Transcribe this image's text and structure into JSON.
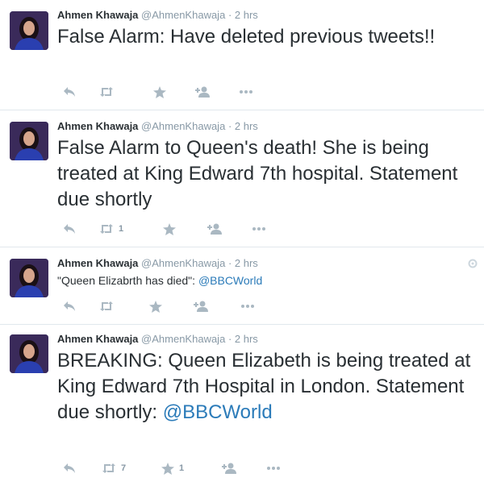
{
  "colors": {
    "link": "#2b7bb9",
    "muted": "#8899a6",
    "icon": "#aab8c2",
    "divider": "#e1e8ed"
  },
  "tweets": [
    {
      "name": "Ahmen Khawaja",
      "handle": "@AhmenKhawaja",
      "sep": "·",
      "time": "2 hrs",
      "text": "False Alarm: Have deleted previous tweets!!",
      "mention": "",
      "retweets": "",
      "favorites": ""
    },
    {
      "name": "Ahmen Khawaja",
      "handle": "@AhmenKhawaja",
      "sep": "·",
      "time": "2 hrs",
      "text": "False Alarm to Queen's death! She is being treated at King Edward 7th hospital. Statement due shortly",
      "mention": "",
      "retweets": "1",
      "favorites": ""
    },
    {
      "name": "Ahmen Khawaja",
      "handle": "@AhmenKhawaja",
      "sep": "·",
      "time": "2 hrs",
      "text": "\"Queen Elizabrth has died\": ",
      "mention": "@BBCWorld",
      "retweets": "",
      "favorites": ""
    },
    {
      "name": "Ahmen Khawaja",
      "handle": "@AhmenKhawaja",
      "sep": "·",
      "time": "2 hrs",
      "text": "BREAKING: Queen Elizabeth is being treated at King Edward 7th Hospital in London. Statement due shortly: ",
      "mention": "@BBCWorld",
      "retweets": "7",
      "favorites": "1"
    }
  ],
  "icons": {
    "reply": "reply-icon",
    "retweet": "retweet-icon",
    "favorite": "star-icon",
    "follow": "follow-icon",
    "more": "more-icon",
    "settings": "gear-icon",
    "avatar": "avatar"
  }
}
